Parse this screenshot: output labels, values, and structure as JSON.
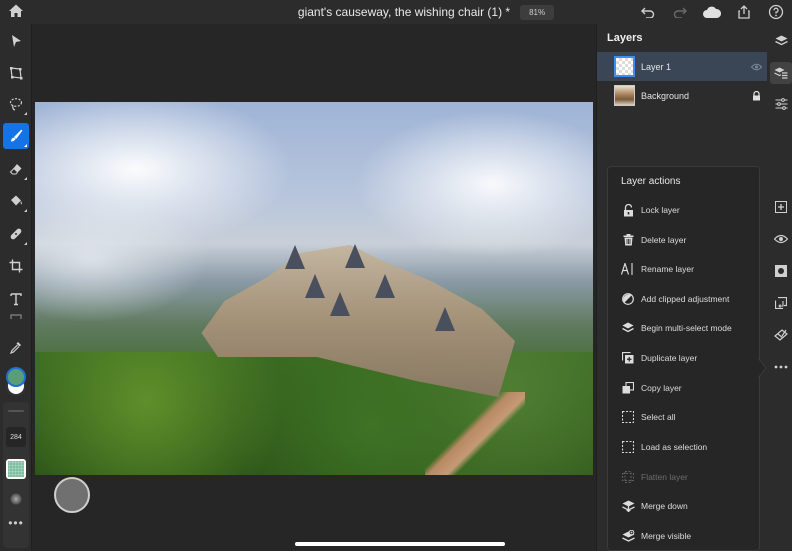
{
  "topbar": {
    "document_title": "giant's causeway, the wishing chair (1) *",
    "zoom_level": "81%",
    "icons": [
      "home-icon",
      "undo-icon",
      "redo-icon",
      "cloud-icon",
      "share-icon",
      "help-icon"
    ]
  },
  "toolbar": {
    "tools": [
      {
        "name": "move-tool",
        "icon": "arrow-pointer-icon"
      },
      {
        "name": "transform-tool",
        "icon": "transform-icon"
      },
      {
        "name": "lasso-tool",
        "icon": "lasso-icon"
      },
      {
        "name": "brush-tool",
        "icon": "brush-icon",
        "active": true
      },
      {
        "name": "eraser-tool",
        "icon": "eraser-icon"
      },
      {
        "name": "fill-tool",
        "icon": "paint-bucket-icon"
      },
      {
        "name": "healing-tool",
        "icon": "bandage-icon"
      },
      {
        "name": "crop-tool",
        "icon": "crop-icon"
      },
      {
        "name": "type-tool",
        "icon": "text-icon"
      },
      {
        "name": "eyedropper-tool",
        "icon": "eyedropper-icon"
      }
    ],
    "foreground_color": "#5a9e78",
    "background_color": "#ffffff",
    "brush_size": "284",
    "more_label": "•••"
  },
  "layers_panel": {
    "title": "Layers",
    "layers": [
      {
        "name": "Layer 1",
        "selected": true,
        "status_icon": "eye-icon"
      },
      {
        "name": "Background",
        "selected": false,
        "status_icon": "lock-icon"
      }
    ]
  },
  "layer_actions": {
    "title": "Layer actions",
    "items": [
      {
        "label": "Lock layer",
        "icon": "lock-open-icon",
        "enabled": true
      },
      {
        "label": "Delete layer",
        "icon": "trash-icon",
        "enabled": true
      },
      {
        "label": "Rename layer",
        "icon": "rename-icon",
        "enabled": true
      },
      {
        "label": "Add clipped adjustment",
        "icon": "adjustment-icon",
        "enabled": true
      },
      {
        "label": "Begin multi-select mode",
        "icon": "layers-stack-icon",
        "enabled": true
      },
      {
        "label": "Duplicate layer",
        "icon": "duplicate-icon",
        "enabled": true
      },
      {
        "label": "Copy layer",
        "icon": "copy-icon",
        "enabled": true
      },
      {
        "label": "Select all",
        "icon": "marquee-icon",
        "enabled": true
      },
      {
        "label": "Load as selection",
        "icon": "marquee-icon",
        "enabled": true
      },
      {
        "label": "Flatten layer",
        "icon": "flatten-icon",
        "enabled": false
      },
      {
        "label": "Merge down",
        "icon": "merge-down-icon",
        "enabled": true
      },
      {
        "label": "Merge visible",
        "icon": "merge-visible-icon",
        "enabled": true
      }
    ]
  },
  "right_rail": {
    "icons": [
      "layers-icon",
      "layer-properties-icon",
      "adjustments-icon",
      "add-layer-icon",
      "visibility-icon",
      "mask-icon",
      "import-icon",
      "clear-icon",
      "more-icon"
    ]
  },
  "colors": {
    "accent": "#1473e6",
    "panel_bg": "#2c2c2c",
    "canvas_bg": "#262626",
    "selected_row": "#3a4556"
  }
}
